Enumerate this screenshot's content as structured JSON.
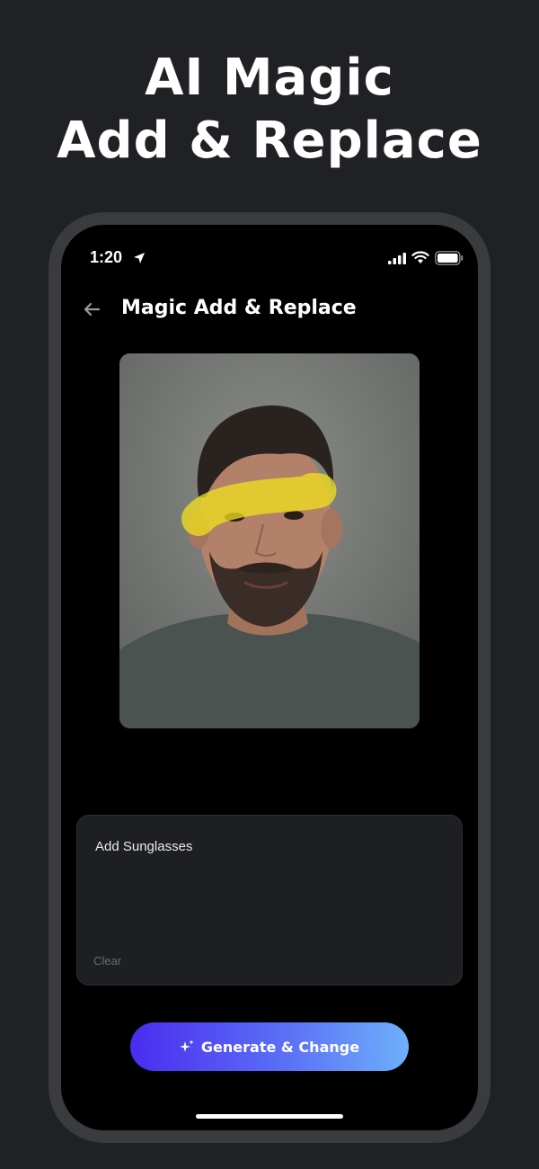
{
  "headline": {
    "line1": "AI Magic",
    "line2": "Add & Replace"
  },
  "status_bar": {
    "time": "1:20"
  },
  "nav": {
    "title": "Magic Add & Replace"
  },
  "prompt": {
    "text": "Add Sunglasses",
    "clear_label": "Clear"
  },
  "generate_button": {
    "label": "Generate & Change"
  },
  "colors": {
    "accent_start": "#4a2cf0",
    "accent_end": "#6eb0fb",
    "mask_highlight": "#f2e21c"
  },
  "icons": [
    "location-arrow-icon",
    "cellular-signal-icon",
    "wifi-icon",
    "battery-icon",
    "back-arrow-icon",
    "sparkle-icon"
  ]
}
